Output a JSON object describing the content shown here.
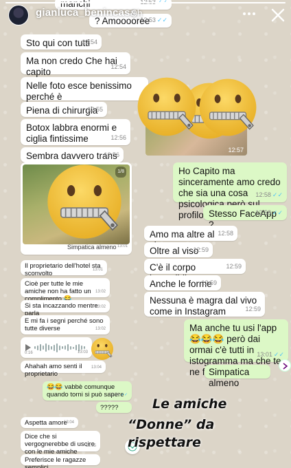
{
  "story": {
    "username": "gianluca_benincasa",
    "time_ago": "9h",
    "progress": 1.0
  },
  "messages": [
    {
      "id": "m1",
      "dir": "in",
      "text": "manchi",
      "time": "12:53",
      "read": true
    },
    {
      "id": "m2",
      "dir": "in",
      "text": "? Amooooree",
      "time": "12:53",
      "read": true
    },
    {
      "id": "m3",
      "dir": "in",
      "text": "Sto qui con tutti",
      "time": "12:54"
    },
    {
      "id": "m4",
      "dir": "in",
      "text": "Ma non credo Che hai capito",
      "time": "12:54"
    },
    {
      "id": "m5",
      "dir": "in",
      "text": "Nelle foto esce benissimo perché è",
      "time": ""
    },
    {
      "id": "m6",
      "dir": "in",
      "text": "Piena di chirurgia",
      "time": "12:55"
    },
    {
      "id": "m7",
      "dir": "in",
      "text": "Botox labbra enormi e ciglia fintissime",
      "time": "12:56"
    },
    {
      "id": "m8",
      "dir": "in",
      "text": "Sembra davvero trans",
      "time": "12:56"
    },
    {
      "id": "m9",
      "dir": "out",
      "text": "Ho Capito ma sinceramente amo credo che sia una cosa psicologica però sul profilo ti somiglia anche",
      "time": "12:58",
      "read": true
    },
    {
      "id": "m10",
      "dir": "out",
      "text": "Stesso FaceApp ?",
      "time": "12:58",
      "read": true
    },
    {
      "id": "m11",
      "dir": "in",
      "text": "Amo ma altre al viso",
      "time": "12:58"
    },
    {
      "id": "m12",
      "dir": "in",
      "text": "Oltre al viso",
      "time": "12:59"
    },
    {
      "id": "m13",
      "dir": "in",
      "text": "C'è il corpo inguaribile",
      "time": "12:59"
    },
    {
      "id": "m14",
      "dir": "in",
      "text": "Anche le forme",
      "time": "12:59"
    },
    {
      "id": "m15",
      "dir": "in",
      "text": "Nessuna è magra dal vivo come in Instagram",
      "time": "12:59"
    },
    {
      "id": "m16",
      "dir": "out",
      "text": "Ma anche tu usi l'app 😂😂😂 però dai ormai c'è tutti in istogramma ma che te ne fott basta che è",
      "time": "13:01",
      "read": true
    },
    {
      "id": "m17",
      "dir": "out",
      "text": "Simpatica almeno",
      "time": "",
      "read": false
    },
    {
      "id": "s1",
      "dir": "in",
      "text": "Il proprietario dell'hotel sta sconvolto",
      "time": "13:01"
    },
    {
      "id": "s2",
      "dir": "in",
      "text": "Cioè per tutte le mie amiche non ha fatto un complimento 😂",
      "time": "13:02"
    },
    {
      "id": "s3",
      "dir": "in",
      "text": "Si sta incazzando mentre parla",
      "time": "13:02"
    },
    {
      "id": "s4",
      "dir": "in",
      "text": "E mi fa i segni perché sono tutte diverse",
      "time": "13:02"
    },
    {
      "id": "s5",
      "dir": "in",
      "text": "Ahahah amo senti il proprietario",
      "time": "13:04"
    },
    {
      "id": "s6",
      "dir": "out",
      "text": "😂😂 vabbè comunque quando torni si può sapere",
      "time": "13:04",
      "read": true
    },
    {
      "id": "s7",
      "dir": "out",
      "text": "?????",
      "time": "13:04",
      "read": true
    },
    {
      "id": "s8",
      "dir": "in",
      "text": "Aspetta amore",
      "time": "13:04"
    },
    {
      "id": "s9",
      "dir": "in",
      "text": "Dice che si vergognerebbe di uscire con le mie amiche",
      "time": "13:05"
    },
    {
      "id": "s10",
      "dir": "in",
      "text": "Preferisce le ragazze semplici",
      "time": ""
    }
  ],
  "photo_small": {
    "time": "12:57",
    "caption": "Simpatica almeno",
    "caption_time": "13:01",
    "counter": "1/8"
  },
  "voice_note": {
    "duration": "0:16",
    "time": "13:03"
  },
  "caption": {
    "line1": "Le amiche",
    "line2": "“Donne” da rispettare"
  },
  "stickers": [
    "zipper-mouth-face",
    "zipper-mouth-face",
    "zipper-mouth-face",
    "zipper-mouth-face",
    "zipper-mouth-face"
  ],
  "colors": {
    "incoming": "#ffffff",
    "outgoing": "#dcf8c6",
    "read_tick": "#4fc3f7",
    "emoji_yellow": "#f5c43a"
  }
}
